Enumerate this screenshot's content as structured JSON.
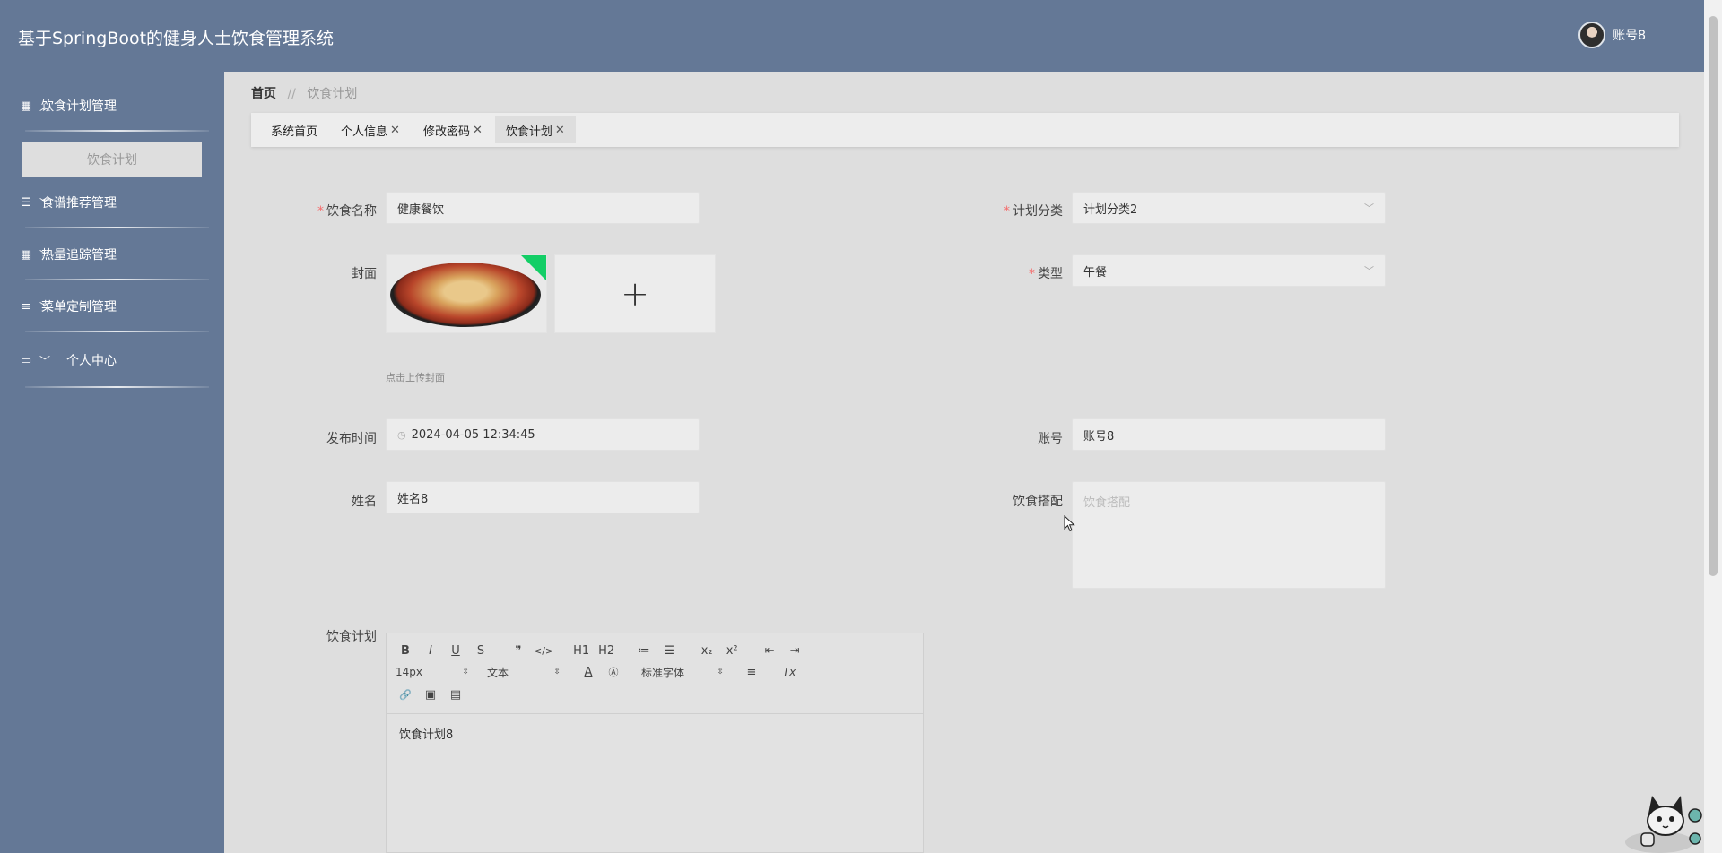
{
  "header": {
    "title": "基于SpringBoot的健身人士饮食管理系统",
    "username": "账号8"
  },
  "sidebar": {
    "menus": [
      {
        "label": "饮食计划管理",
        "icon": "grid-icon",
        "expanded": true
      },
      {
        "label": "食谱推荐管理",
        "icon": "list-icon",
        "expanded": false
      },
      {
        "label": "热量追踪管理",
        "icon": "grid-icon",
        "expanded": false
      },
      {
        "label": "菜单定制管理",
        "icon": "menu-icon",
        "expanded": false
      },
      {
        "label": "个人中心",
        "icon": "card-icon",
        "expanded": false
      }
    ],
    "active_sub": "饮食计划"
  },
  "breadcrumb": {
    "home": "首页",
    "sep": "//",
    "current": "饮食计划"
  },
  "tabs": [
    {
      "label": "系统首页",
      "closable": false,
      "active": false
    },
    {
      "label": "个人信息",
      "closable": true,
      "active": false
    },
    {
      "label": "修改密码",
      "closable": true,
      "active": false
    },
    {
      "label": "饮食计划",
      "closable": true,
      "active": true
    }
  ],
  "form": {
    "name_label": "饮食名称",
    "name_value": "健康餐饮",
    "category_label": "计划分类",
    "category_value": "计划分类2",
    "cover_label": "封面",
    "type_label": "类型",
    "type_value": "午餐",
    "cover_hint": "点击上传封面",
    "add_symbol": "+",
    "publish_label": "发布时间",
    "publish_value": "2024-04-05 12:34:45",
    "account_label": "账号",
    "account_value": "账号8",
    "realname_label": "姓名",
    "realname_value": "姓名8",
    "pairing_label": "饮食搭配",
    "pairing_placeholder": "饮食搭配",
    "plan_label": "饮食计划",
    "plan_content": "饮食计划8"
  },
  "editor": {
    "row1": [
      "B",
      "I",
      "U",
      "S",
      "❞",
      "</>",
      "H1",
      "H2",
      "≔",
      "☰",
      "x₂",
      "x²",
      "⇤",
      "⇥"
    ],
    "size_select": "14px",
    "text_select": "文本",
    "font_select": "标准字体",
    "row2_icons": [
      "A",
      "Ⓐ",
      "≡",
      "Tx"
    ],
    "row3": [
      "🔗",
      "▣",
      "▤"
    ]
  },
  "colors": {
    "header_bg": "#647896",
    "sidebar_bg": "#647896",
    "content_bg": "#dedede",
    "required": "#f56c6c",
    "upload_badge": "#13ce66"
  }
}
